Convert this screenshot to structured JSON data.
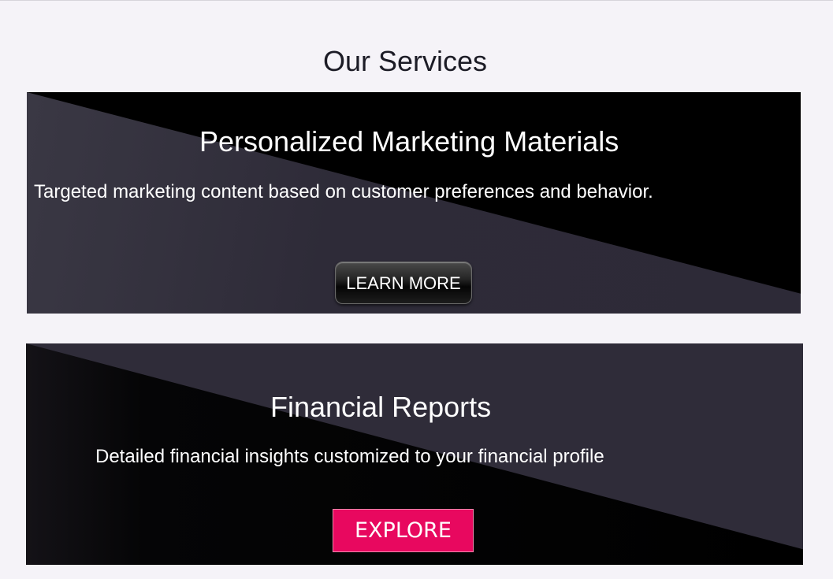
{
  "page": {
    "title": "Our Services"
  },
  "services": [
    {
      "title": "Personalized Marketing Materials",
      "description": "Targeted marketing content based on customer preferences and behavior.",
      "button_label": "LEARN MORE"
    },
    {
      "title": "Financial Reports",
      "description": "Detailed financial insights customized to your financial profile",
      "button_label": "EXPLORE"
    }
  ],
  "colors": {
    "page_background": "#f5f3f8",
    "card_dark": "#000000",
    "card_slate": "#2f2c39",
    "explore_accent": "#e8085f"
  }
}
